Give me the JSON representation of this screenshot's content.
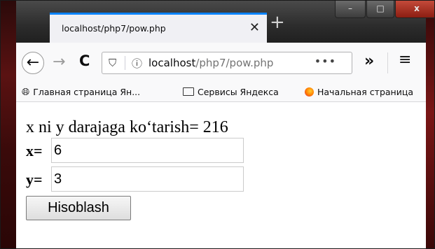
{
  "browser": {
    "tab_title": "localhost/php7/pow.php",
    "tab_close": "✕",
    "new_tab": "+",
    "url_host": "localhost",
    "url_path": "/php7/pow.php",
    "page_actions": "•••",
    "overflow": "»",
    "menu": "≡",
    "window_buttons": [
      "–",
      "□",
      "x"
    ]
  },
  "bookmarks": [
    {
      "icon": "globe-icon",
      "label": "Главная страница Ян..."
    },
    {
      "icon": "folder-icon",
      "label": "Сервисы Яндекса"
    },
    {
      "icon": "firefox-icon",
      "label": "Начальная страница"
    }
  ],
  "page": {
    "result_text": "x ni y darajaga ko‘tarish= 216",
    "x_label": "x=",
    "x_value": "6",
    "y_label": "y=",
    "y_value": "3",
    "submit_label": "Hisoblash"
  }
}
